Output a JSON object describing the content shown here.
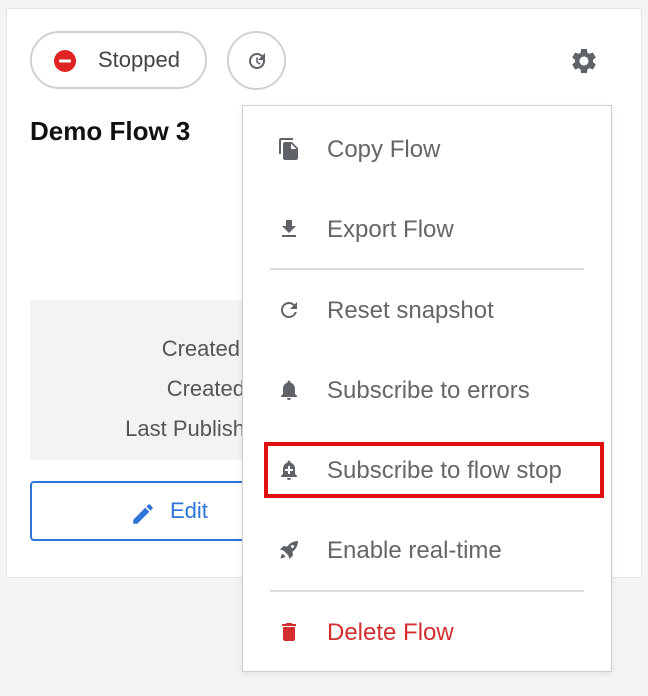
{
  "flow": {
    "status": "Stopped",
    "title": "Demo Flow 3"
  },
  "meta": {
    "created_label_1": "Created",
    "created_label_2": "Created",
    "last_published_label": "Last Publish"
  },
  "actions": {
    "edit_label": "Edit"
  },
  "menu": {
    "items": [
      {
        "label": "Copy Flow",
        "icon": "copy-icon"
      },
      {
        "label": "Export Flow",
        "icon": "download-icon"
      },
      {
        "label": "Reset snapshot",
        "icon": "reset-icon"
      },
      {
        "label": "Subscribe to errors",
        "icon": "bell-icon"
      },
      {
        "label": "Subscribe to flow stop",
        "icon": "bell-plus-icon"
      },
      {
        "label": "Enable real-time",
        "icon": "rocket-icon"
      },
      {
        "label": "Delete Flow",
        "icon": "trash-icon"
      }
    ],
    "highlighted_item": "Subscribe to flow stop"
  },
  "colors": {
    "accent": "#2f74d8",
    "danger": "#d32f2f",
    "stop_badge": "#e02424",
    "highlight": "#e01010",
    "icon_gray": "#5f6368"
  }
}
